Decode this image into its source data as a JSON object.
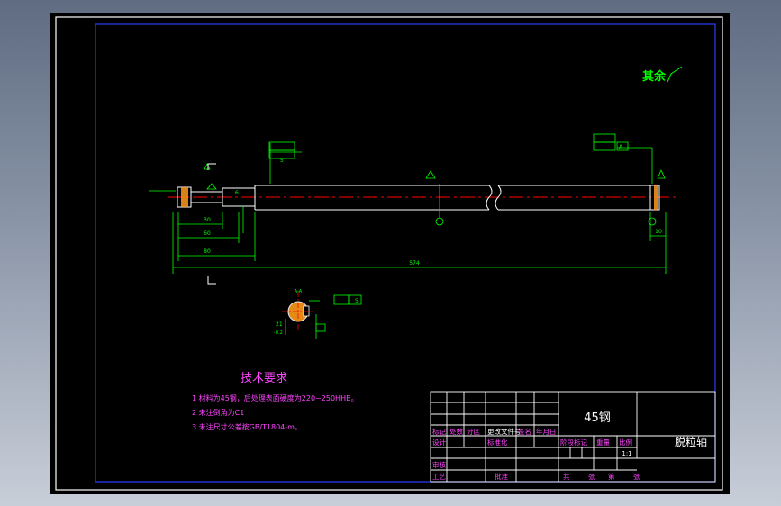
{
  "drawing": {
    "roughness_label": "其余",
    "tech_title": "技术要求",
    "tech_notes": [
      "1 材料为45钢，后处理表面硬度为220~250HHB。",
      "2 未注倒角为C1",
      "3 未注尺寸公差按GB/T1804-m。"
    ],
    "dims": {
      "overall": "574",
      "d80": "80",
      "d60": "60",
      "d30": "30",
      "d10": "10",
      "d6": "6",
      "d5": "5",
      "sec_a": "21",
      "sec_b": "-0.2",
      "sec_val": "5"
    },
    "datum_a": "A",
    "section_label": "A-A"
  },
  "title_block": {
    "material": "45钢",
    "part_name": "脱粒轴",
    "scale": "1:1",
    "header_labels": [
      "标记",
      "处数",
      "分区",
      "更改文件号",
      "签名",
      "年月日"
    ],
    "design_label": "设计",
    "standardize_label": "标准化",
    "stage_mark_label": "阶段标记",
    "weight_label": "重量",
    "scale_label": "比例",
    "review_label": "审核",
    "process_label": "工艺",
    "approve_label": "批准",
    "sheet_labels": [
      "共",
      "张",
      "第",
      "张"
    ]
  },
  "colors": {
    "background": "#000000",
    "frame": "#0000ff",
    "lines": "#ffffff",
    "dimension": "#00ff00",
    "annotation": "#ff00ff",
    "center_line": "#ff0000"
  }
}
